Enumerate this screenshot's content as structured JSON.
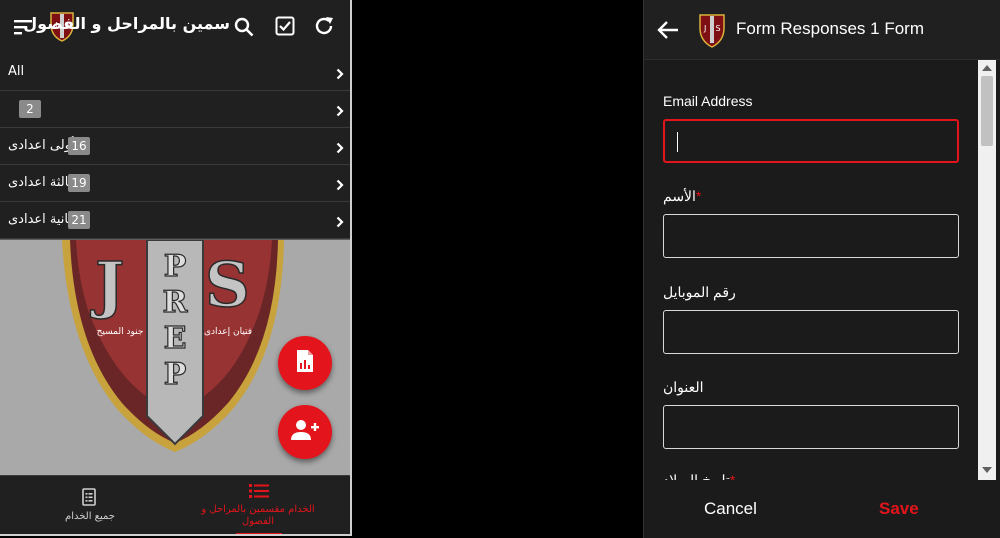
{
  "left": {
    "appbar": {
      "title": "سمين بالمراحل و الفصول",
      "icons": [
        "menu-sort-icon",
        "shield-logo-icon",
        "search-icon",
        "checkbox-icon",
        "refresh-icon"
      ]
    },
    "list": [
      {
        "label": "All",
        "count": ""
      },
      {
        "label": "",
        "count": "2"
      },
      {
        "label": "أولى اعدادى",
        "count": "16"
      },
      {
        "label": "ثالثة اعدادى",
        "count": "19"
      },
      {
        "label": "ثانية اعدادى",
        "count": "21"
      }
    ],
    "logo": {
      "letters": [
        "J",
        "P",
        "R",
        "E",
        "P",
        "S"
      ],
      "left_caption": "جنود المسيح",
      "right_caption": "فتيان إعدادى"
    },
    "fabs": [
      "report-icon",
      "add-person-icon"
    ],
    "bottom_nav": {
      "all_label": "جميع الخدام",
      "selected_label": "الخدام مقسمين بالمراحل و الفصول"
    }
  },
  "right": {
    "title": "Form Responses 1 Form",
    "fields": [
      {
        "label": "Email Address",
        "required": false,
        "value": ""
      },
      {
        "label": "الأسم",
        "required": true,
        "value": ""
      },
      {
        "label": "رقم الموبايل",
        "required": false,
        "value": ""
      },
      {
        "label": "العنوان",
        "required": false,
        "value": ""
      }
    ],
    "partial_label": "تاريخ الميلاد",
    "cancel": "Cancel",
    "save": "Save"
  },
  "colors": {
    "accent": "#e3141b",
    "bar": "#202020",
    "panel": "#1b1b1b",
    "logo_bg": "#a9a9a9"
  }
}
